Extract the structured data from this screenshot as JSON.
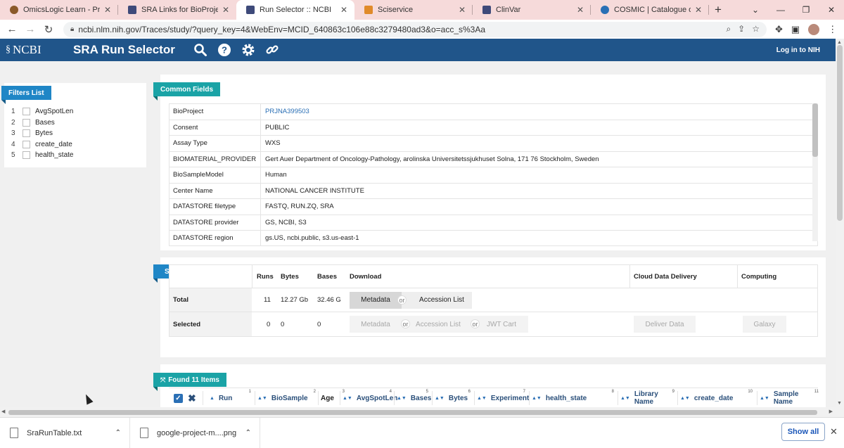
{
  "browser": {
    "tabs": [
      {
        "title": "OmicsLogic Learn - Project",
        "color": "#8a5a2a"
      },
      {
        "title": "SRA Links for BioProject (Se",
        "color": "#3e4a7a"
      },
      {
        "title": "Run Selector :: NCBI",
        "color": "#3e4a7a",
        "active": true
      },
      {
        "title": "Sciservice",
        "color": "#e08a2a"
      },
      {
        "title": "ClinVar",
        "color": "#3e4a7a"
      },
      {
        "title": "COSMIC | Catalogue of Som",
        "color": "#2a6fb5"
      }
    ],
    "new_tab_label": "+",
    "url": "ncbi.nlm.nih.gov/Traces/study/?query_key=4&WebEnv=MCID_640863c106e88c3279480ad3&o=acc_s%3Aa"
  },
  "header": {
    "logo": "NCBI",
    "title": "SRA Run Selector",
    "login": "Log in to NIH"
  },
  "filters": {
    "label": "Filters List",
    "items": [
      {
        "num": "1",
        "label": "AvgSpotLen"
      },
      {
        "num": "2",
        "label": "Bases"
      },
      {
        "num": "3",
        "label": "Bytes"
      },
      {
        "num": "4",
        "label": "create_date"
      },
      {
        "num": "5",
        "label": "health_state"
      }
    ]
  },
  "common_fields": {
    "label": "Common Fields",
    "rows": [
      {
        "key": "BioProject",
        "value": "PRJNA399503",
        "link": true
      },
      {
        "key": "Consent",
        "value": "PUBLIC"
      },
      {
        "key": "Assay Type",
        "value": "WXS"
      },
      {
        "key": "BIOMATERIAL_PROVIDER",
        "value": "Gert Auer Department of Oncology-Pathology, arolinska Universitetssjukhuset Solna, 171 76 Stockholm, Sweden"
      },
      {
        "key": "BioSampleModel",
        "value": "Human"
      },
      {
        "key": "Center Name",
        "value": "NATIONAL CANCER INSTITUTE"
      },
      {
        "key": "DATASTORE filetype",
        "value": "FASTQ, RUN.ZQ, SRA"
      },
      {
        "key": "DATASTORE provider",
        "value": "GS, NCBI, S3"
      },
      {
        "key": "DATASTORE region",
        "value": "gs.US, ncbi.public, s3.us-east-1"
      }
    ]
  },
  "select": {
    "label": "Select",
    "headers": {
      "runs": "Runs",
      "bytes": "Bytes",
      "bases": "Bases",
      "download": "Download",
      "cloud": "Cloud Data Delivery",
      "computing": "Computing"
    },
    "total": {
      "label": "Total",
      "runs": "11",
      "bytes": "12.27 Gb",
      "bases": "32.46 G"
    },
    "selected": {
      "label": "Selected",
      "runs": "0",
      "bytes": "0",
      "bases": "0"
    },
    "buttons": {
      "metadata": "Metadata",
      "accession_list": "Accession List",
      "jwt_cart": "JWT Cart",
      "deliver_data": "Deliver Data",
      "galaxy": "Galaxy",
      "or": "or"
    }
  },
  "results": {
    "label": "Found 11 Items",
    "columns": [
      {
        "label": "Run",
        "num": "1"
      },
      {
        "label": "BioSample",
        "num": "2"
      },
      {
        "label": "Age",
        "num": "3"
      },
      {
        "label": "AvgSpotLen",
        "num": "4"
      },
      {
        "label": "Bases",
        "num": "5"
      },
      {
        "label": "Bytes",
        "num": "6"
      },
      {
        "label": "Experiment",
        "num": "7"
      },
      {
        "label": "health_state",
        "num": "8"
      },
      {
        "label": "Library Name",
        "num": "9"
      },
      {
        "label": "create_date",
        "num": "10"
      },
      {
        "label": "Sample Name",
        "num": "11"
      }
    ]
  },
  "downloads": {
    "items": [
      "SraRunTable.txt",
      "google-project-m....png"
    ],
    "show_all": "Show all"
  }
}
